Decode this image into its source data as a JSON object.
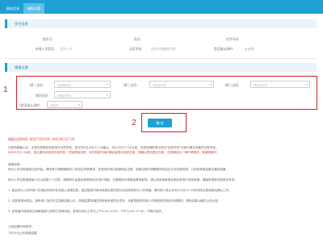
{
  "tabs": [
    "基本信息",
    "填报志愿"
  ],
  "student_section": {
    "title": "学生信息",
    "fields": [
      {
        "label": "报名号:",
        "value": ""
      },
      {
        "label": "姓名:",
        "value": ""
      },
      {
        "label": "证件号码:",
        "value": ""
      },
      {
        "label": "申请入学类型:",
        "value": "积分入学"
      },
      {
        "label": "志愿学校:",
        "value": "民办义务教育学校"
      },
      {
        "label": "是否服从调剂:",
        "value": "未选择"
      }
    ]
  },
  "volunteer_section": {
    "title": "填报志愿",
    "first_label": "*第一志愿:",
    "second_label": "*第二志愿:",
    "third_label": "*第三志愿:",
    "fourth_label": "第四志愿:",
    "adjust_label": "*是否服从调剂:",
    "select_placeholder": "请选择学校",
    "adjust_placeholder": "请选择",
    "confirm_label": "确 定"
  },
  "annotations": {
    "box1": "1",
    "box2": "2"
  },
  "notice": {
    "date_line": "填报志愿时间: 8月27日9:00—8月28日17:30",
    "p1": "志愿填报截止后，花费志愿服务系统将在志愿学校，依次在8月28日17:30截止，8月29日17:30点前，志愿填报即表示您对\"志愿学校\"为家长确认的最终志愿学校。",
    "p1b": "8月29日17:30前，招生服务系统将在各学校，开始抓取志愿，未在规定时间内确定者视为放弃志愿，请确认是否提交志愿。志愿确定后一律不得更改，请谨慎操作！",
    "p2_title": "填报说明:",
    "p2": "积分入学志愿填报已经开始，请申请人按照最新的入学招生简章要求，在规定时间内填报相应志愿。填报志愿时请根据学校招生计划合理选择，公布的录取结果为最终结果。",
    "p3": "积分入学志愿填报每人可以填报三个志愿，按照积分由高到低顺序依次进行录取，志愿顺序对录取结果有影响，请认真阅读填报说明后再进行志愿填报，确保所填报志愿真实有效。",
    "p4": "1. 各区积分入学申请人在规定时间内在系统上填报志愿，超过规定时间未填报志愿的视为自动放弃积分入学资格。请申请人务必在8月29日17:30前完成志愿填报及确认工作。",
    "p5": "2. 志愿填报完成后，请申请人及时关注录取结果公示，录取结果将通过短信和系统同步发布，未被录取的申请人可按照有关规定申请调剂，调剂结果以最终公布为准。",
    "p6": "3. 如有疑问请咨询当地教育部门或拨打咨询电话，咨询时间为工作日上午9:00-12:00，下午14:00-17:30，节假日除外。",
    "p7_title": "公布结果时间安排:",
    "p7": "7月23日公布录取结果。"
  }
}
